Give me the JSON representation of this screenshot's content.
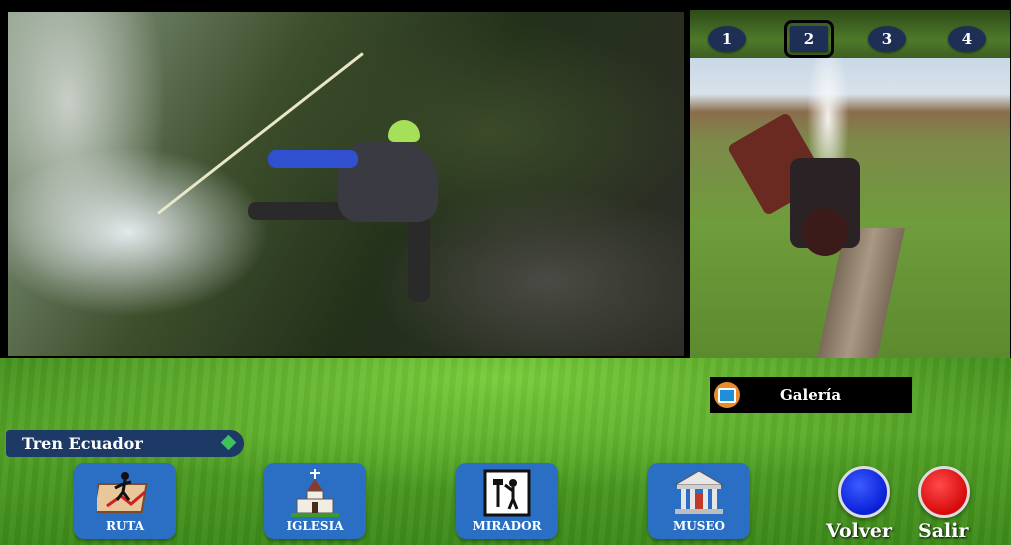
{
  "slideshow": {
    "tabs": [
      "1",
      "2",
      "3",
      "4"
    ],
    "selected_tab": "2"
  },
  "gallery": {
    "label": "Galería",
    "icon": "camera-icon"
  },
  "app": {
    "title": "Tren Ecuador"
  },
  "nav": [
    {
      "label": "RUTA",
      "icon": "route-map-icon"
    },
    {
      "label": "IGLESIA",
      "icon": "church-icon"
    },
    {
      "label": "MIRADOR",
      "icon": "viewpoint-icon"
    },
    {
      "label": "MUSEO",
      "icon": "museum-icon"
    }
  ],
  "actions": {
    "back_label": "Volver",
    "exit_label": "Salir"
  },
  "colors": {
    "nav_button": "#2b6fc4",
    "title_bar": "#1d3a66",
    "back_button": "#0a1fd8",
    "exit_button": "#d60a0a"
  }
}
